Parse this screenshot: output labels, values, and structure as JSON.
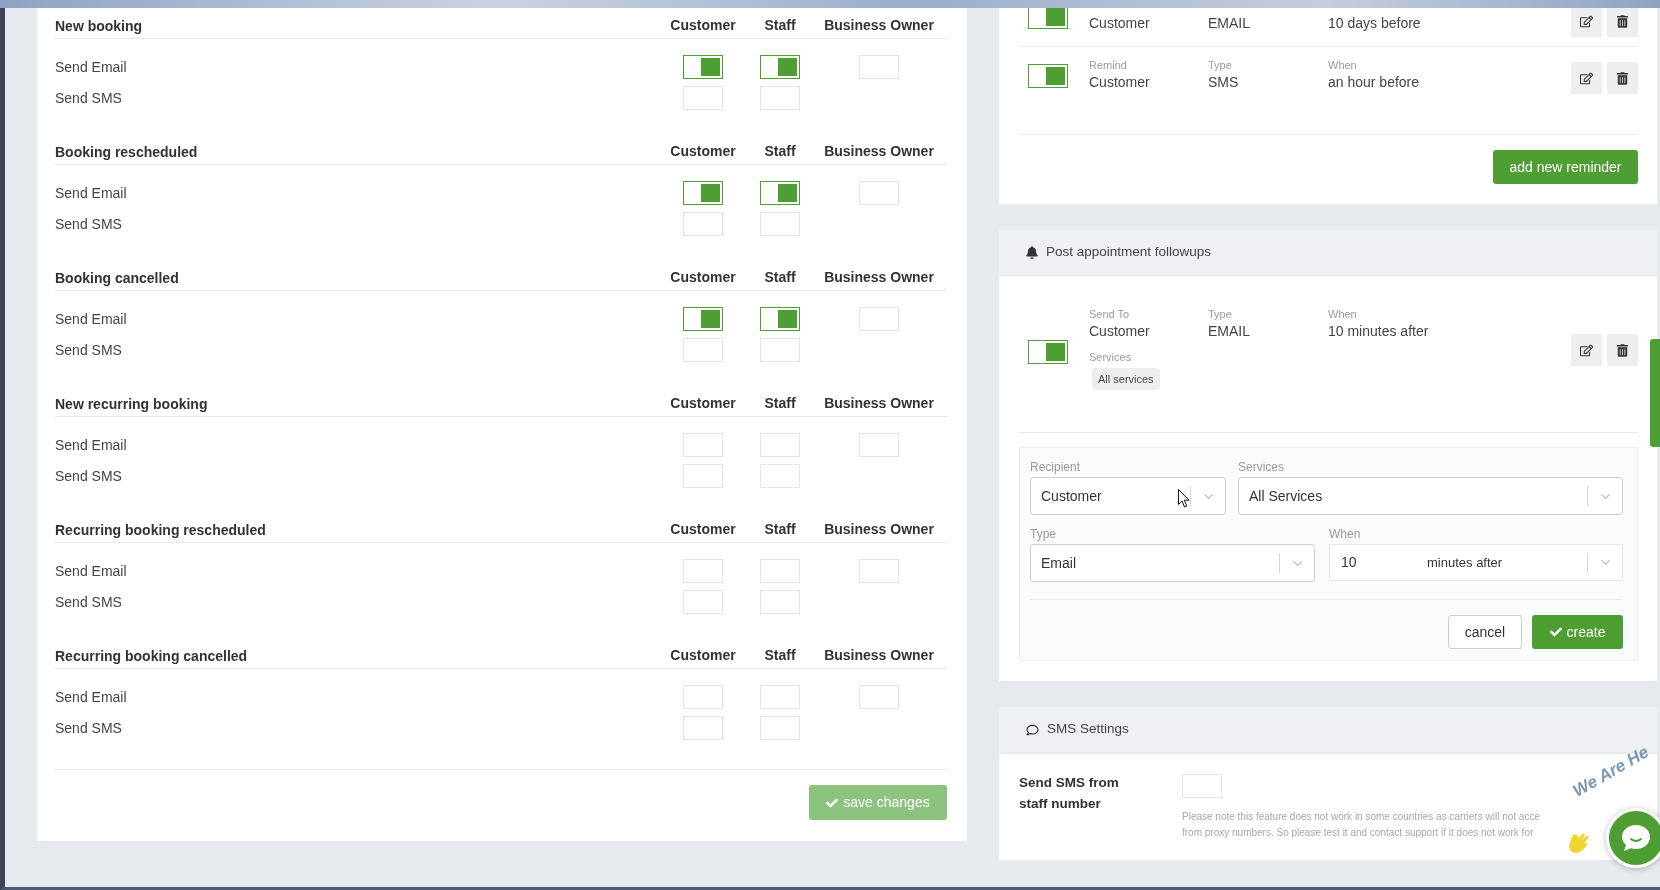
{
  "notifications": {
    "sections": [
      {
        "title": "New booking",
        "columns": [
          "Customer",
          "Staff",
          "Business Owner"
        ],
        "rows": [
          {
            "label": "Send Email",
            "toggles": [
              {
                "on": true
              },
              {
                "on": true
              },
              {
                "on": false
              }
            ]
          },
          {
            "label": "Send SMS",
            "toggles": [
              {
                "on": false
              },
              {
                "on": false
              }
            ]
          }
        ]
      },
      {
        "title": "Booking rescheduled",
        "columns": [
          "Customer",
          "Staff",
          "Business Owner"
        ],
        "rows": [
          {
            "label": "Send Email",
            "toggles": [
              {
                "on": true
              },
              {
                "on": true
              },
              {
                "on": false
              }
            ]
          },
          {
            "label": "Send SMS",
            "toggles": [
              {
                "on": false
              },
              {
                "on": false
              }
            ]
          }
        ]
      },
      {
        "title": "Booking cancelled",
        "columns": [
          "Customer",
          "Staff",
          "Business Owner"
        ],
        "rows": [
          {
            "label": "Send Email",
            "toggles": [
              {
                "on": true
              },
              {
                "on": true
              },
              {
                "on": false
              }
            ]
          },
          {
            "label": "Send SMS",
            "toggles": [
              {
                "on": false
              },
              {
                "on": false
              }
            ]
          }
        ]
      },
      {
        "title": "New recurring booking",
        "columns": [
          "Customer",
          "Staff",
          "Business Owner"
        ],
        "rows": [
          {
            "label": "Send Email",
            "toggles": [
              {
                "on": false
              },
              {
                "on": false
              },
              {
                "on": false
              }
            ]
          },
          {
            "label": "Send SMS",
            "toggles": [
              {
                "on": false
              },
              {
                "on": false
              }
            ]
          }
        ]
      },
      {
        "title": "Recurring booking rescheduled",
        "columns": [
          "Customer",
          "Staff",
          "Business Owner"
        ],
        "rows": [
          {
            "label": "Send Email",
            "toggles": [
              {
                "on": false
              },
              {
                "on": false
              },
              {
                "on": false
              }
            ]
          },
          {
            "label": "Send SMS",
            "toggles": [
              {
                "on": false
              },
              {
                "on": false
              }
            ]
          }
        ]
      },
      {
        "title": "Recurring booking cancelled",
        "columns": [
          "Customer",
          "Staff",
          "Business Owner"
        ],
        "rows": [
          {
            "label": "Send Email",
            "toggles": [
              {
                "on": false
              },
              {
                "on": false
              },
              {
                "on": false
              }
            ]
          },
          {
            "label": "Send SMS",
            "toggles": [
              {
                "on": false
              },
              {
                "on": false
              }
            ]
          }
        ]
      }
    ],
    "save_button": {
      "label": "save changes",
      "disabled": true
    }
  },
  "reminders": {
    "items": [
      {
        "on": true,
        "fields": [
          {
            "value": "Customer"
          },
          {
            "value": "EMAIL"
          },
          {
            "value": "10 days before"
          }
        ]
      },
      {
        "on": true,
        "fields": [
          {
            "label": "Remind",
            "value": "Customer"
          },
          {
            "label": "Type",
            "value": "SMS"
          },
          {
            "label": "When",
            "value": "an hour before"
          }
        ]
      }
    ],
    "add_button": "add new reminder"
  },
  "followups": {
    "title": "Post appointment followups",
    "items": [
      {
        "on": true,
        "fields": [
          {
            "label": "Send To",
            "value": "Customer"
          },
          {
            "label": "Type",
            "value": "EMAIL"
          },
          {
            "label": "When",
            "value": "10 minutes after"
          }
        ],
        "services_label": "Services",
        "services": [
          "All services"
        ]
      }
    ],
    "form": {
      "recipient": {
        "label": "Recipient",
        "value": "Customer"
      },
      "services": {
        "label": "Services",
        "value": "All Services"
      },
      "type": {
        "label": "Type",
        "value": "Email"
      },
      "when": {
        "label": "When",
        "amount": "10",
        "unit": "minutes after"
      },
      "buttons": [
        {
          "kind": "cancel",
          "label": "cancel"
        },
        {
          "kind": "create",
          "label": "create"
        }
      ]
    }
  },
  "sms_settings": {
    "title": "SMS Settings",
    "label": "Send SMS from staff number",
    "on": false,
    "note_lines": [
      "Please note this feature does not work in some countries as carriers will not acce",
      "from proxy numbers. So please test it and contact support if it does not work for"
    ]
  },
  "chat_widget": {
    "caption": "We Are He"
  }
}
